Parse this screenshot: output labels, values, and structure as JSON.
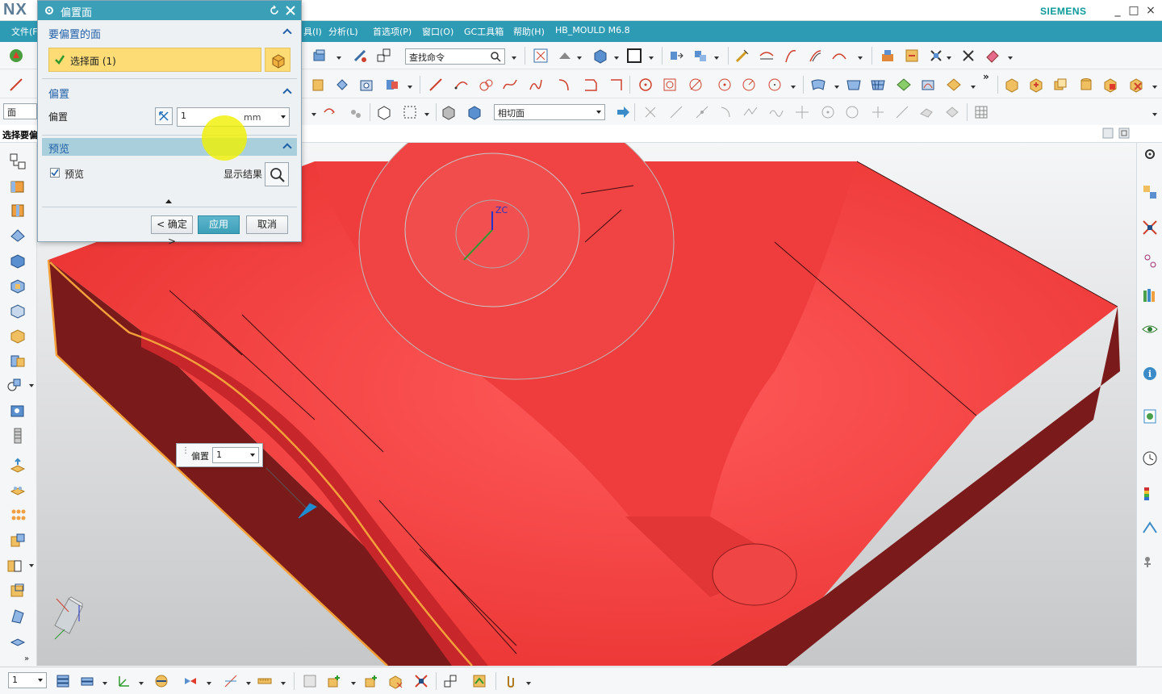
{
  "app": {
    "logo": "NX",
    "brand": "SIEMENS",
    "window_controls": [
      "_",
      "□",
      "×"
    ]
  },
  "menu": {
    "items": [
      "文件(F)",
      "具(I)",
      "分析(L)",
      "首选项(P)",
      "窗口(O)",
      "GC工具箱",
      "帮助(H)",
      "HB_MOULD M6.8"
    ]
  },
  "toolbar": {
    "search_placeholder": "查找命令",
    "filter_value": "面",
    "tangent_value": "相切面"
  },
  "selbar": {
    "label": "选择要偏"
  },
  "dialog": {
    "title": "偏置面",
    "sections": {
      "faces": {
        "title": "要偏置的面",
        "select_label": "选择面 (1)"
      },
      "offset": {
        "title": "偏置",
        "label": "偏置",
        "value": "1",
        "unit": "mm"
      },
      "preview": {
        "title": "预览",
        "checkbox_label": "预览",
        "show_result_label": "显示结果"
      }
    },
    "buttons": {
      "ok": "< 确定 >",
      "apply": "应用",
      "cancel": "取消"
    }
  },
  "floating_offset": {
    "label": "偏置",
    "value": "1"
  },
  "bottombar": {
    "layer_value": "1"
  },
  "colors": {
    "accent": "#2e9bb5",
    "part_red": "#f23b3b",
    "part_dark_red": "#7a1a1a",
    "highlight_orange": "#f4a03a",
    "selection_yellow": "#fddc76"
  }
}
